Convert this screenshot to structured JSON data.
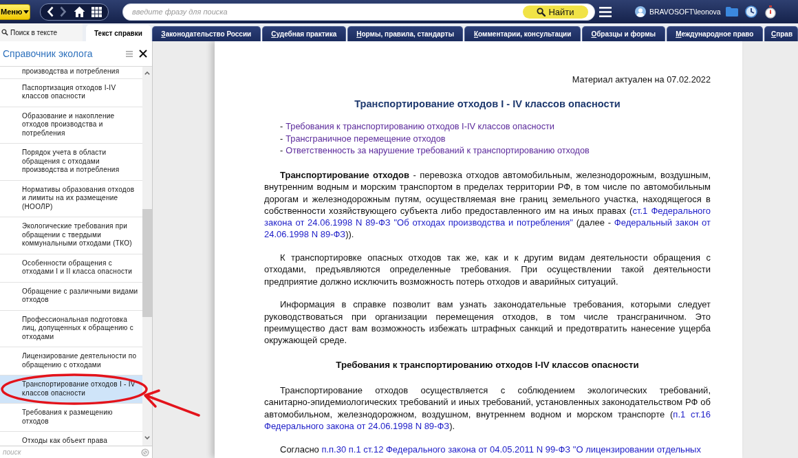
{
  "toolbar": {
    "menu_button": "Меню",
    "nav_buttons": [
      {
        "kind": "back",
        "disabled": false
      },
      {
        "kind": "forward",
        "disabled": true
      },
      {
        "kind": "home",
        "disabled": false
      },
      {
        "kind": "apps",
        "disabled": false
      }
    ],
    "search": {
      "placeholder": "введите фразу для поиска",
      "button": "Найти"
    },
    "user": "BRAVOSOFT\\leonova"
  },
  "tabs": {
    "text_search": "Поиск в тексте",
    "items": [
      {
        "label": "Текст справки",
        "selected": true
      },
      {
        "label": "Законодательство России",
        "selected": false
      },
      {
        "label": "Судебная практика",
        "selected": false
      },
      {
        "label": "Нормы, правила, стандарты",
        "selected": false
      },
      {
        "label": "Комментарии, консультации",
        "selected": false
      },
      {
        "label": "Образцы и формы",
        "selected": false
      },
      {
        "label": "Международное право",
        "selected": false
      },
      {
        "label": "Справ",
        "selected": false
      }
    ]
  },
  "sidebar": {
    "title": "Справочник эколога",
    "items": [
      {
        "label": "производства и потребления",
        "selected": false,
        "circled": false
      },
      {
        "label": "Паспортизация отходов I-IV классов опасности",
        "selected": false,
        "circled": false
      },
      {
        "label": "Образование и накопление отходов производства и потребления",
        "selected": false,
        "circled": false
      },
      {
        "label": "Порядок учета в области обращения с отходами производства и потребления",
        "selected": false,
        "circled": false
      },
      {
        "label": "Нормативы образования отходов и лимиты на их размещение (НООЛР)",
        "selected": false,
        "circled": false
      },
      {
        "label": "Экологические требования при обращении с твердыми коммунальными отходами (ТКО)",
        "selected": false,
        "circled": false
      },
      {
        "label": "Особенности обращения с отходами I и II класса опасности",
        "selected": false,
        "circled": false
      },
      {
        "label": "Обращение с различными видами отходов",
        "selected": false,
        "circled": false
      },
      {
        "label": "Профессиональная подготовка лиц, допущенных к обращению с отходами",
        "selected": false,
        "circled": false
      },
      {
        "label": "Лицензирование деятельности по обращению с отходами",
        "selected": false,
        "circled": false
      },
      {
        "label": "Транспортирование отходов I - IV классов опасности",
        "selected": true,
        "circled": true
      },
      {
        "label": "Требования к размещению отходов",
        "selected": false,
        "circled": false
      },
      {
        "label": "Отходы как объект права",
        "selected": false,
        "circled": false
      }
    ],
    "search": {
      "placeholder": "поиск"
    }
  },
  "document": {
    "date_note": "Материал актуален на 07.02.2022",
    "title": "Транспортирование отходов I - IV классов опасности",
    "contents": [
      {
        "dash": "-",
        "link": "Требования к транспортированию отходов I-IV классов опасности"
      },
      {
        "dash": "-",
        "link": "Трансграничное перемещение отходов"
      },
      {
        "dash": "-",
        "link": "Ответственность за нарушение требований к транспортированию отходов"
      }
    ],
    "blocks": [
      {
        "kind": "paragraph",
        "segments": [
          {
            "kind": "text",
            "text": "**Транспортирование отходов** - перевозка отходов автомобильным, железнодорожным, воздушным, внутренним водным и морским транспортом в пределах территории РФ, в том числе по автомобильным дорогам и железнодорожным путям, осуществляемая вне границ земельного участка, находящегося в собственности хозяйствующего субъекта либо предоставленного им на иных правах ("
          },
          {
            "kind": "link",
            "text": "ст.1 Федерального"
          },
          {
            "kind": "space"
          },
          {
            "kind": "link",
            "text": "закона от 24.06.1998 N 89-ФЗ \"Об отходах производства и потребления\""
          },
          {
            "kind": "text",
            "text": " (далее - "
          },
          {
            "kind": "link",
            "text": "Федеральный закон от"
          },
          {
            "kind": "space"
          },
          {
            "kind": "link",
            "text": "24.06.1998 N 89-ФЗ"
          },
          {
            "kind": "text",
            "text": "))."
          }
        ]
      },
      {
        "kind": "paragraph",
        "segments": [
          {
            "kind": "text",
            "text": "К транспортировке опасных отходов так же, как и к другим видам деятельности обращения с отходами, предъявляются определенные требования. При осуществлении такой деятельности предприятие должно исключить возможность потерь отходов и аварийных ситуаций."
          }
        ]
      },
      {
        "kind": "paragraph",
        "segments": [
          {
            "kind": "text",
            "text": "Информация в справке позволит вам узнать законодательные требования, которыми следует руководствоваться при организации перемещения отходов, в том числе трансграничном. Это преимущество даст вам возможность избежать штрафных санкций и предотвратить нанесение ущерба окружающей среде."
          }
        ]
      },
      {
        "kind": "heading",
        "text": "Требования к транспортированию отходов I-IV классов опасности"
      },
      {
        "kind": "paragraph",
        "segments": [
          {
            "kind": "text",
            "text": "Транспортирование отходов осуществляется с соблюдением экологических требований, санитарно-эпидемиологических требований и иных требований, установленных законодательством РФ об автомобильном, железнодорожном, воздушном, внутреннем водном и морском транспорте ("
          },
          {
            "kind": "link",
            "text": "п.1 ст.16"
          },
          {
            "kind": "space"
          },
          {
            "kind": "link",
            "text": "Федерального закона от 24.06.1998 N 89-ФЗ"
          },
          {
            "kind": "text",
            "text": ")."
          }
        ]
      },
      {
        "kind": "paragraph",
        "segments": [
          {
            "kind": "text",
            "text": "Согласно "
          },
          {
            "kind": "link",
            "text": "п.п.30 п.1 ст.12 Федерального закона от 04.05.2011 N 99-ФЗ \"О лицензировании отдельных"
          }
        ]
      }
    ]
  }
}
